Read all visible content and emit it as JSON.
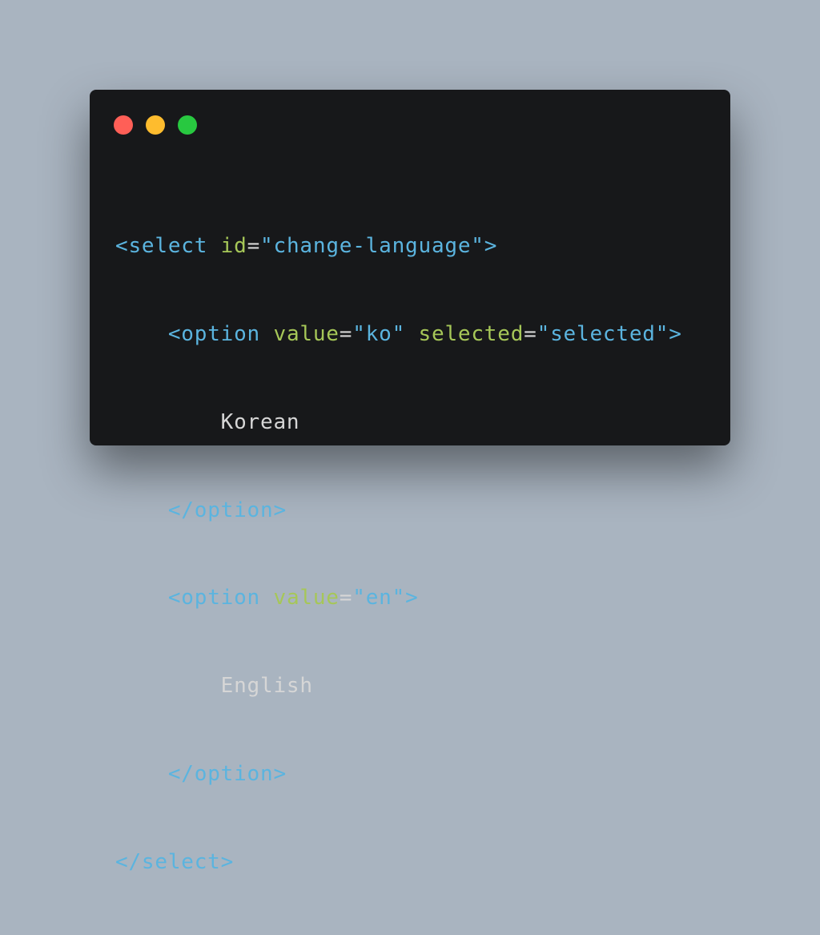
{
  "window": {
    "controls": {
      "close_color": "#ff5f57",
      "minimize_color": "#febc2e",
      "zoom_color": "#28c840"
    }
  },
  "code": {
    "colors": {
      "tag": "#5bb4df",
      "attribute": "#a6c758",
      "string": "#5bb4df",
      "text": "#d6d6d6"
    },
    "lines": [
      {
        "indent": "",
        "open": "<select",
        "attrs": [
          {
            "name": "id",
            "eq": "=",
            "value": "\"change-language\""
          }
        ],
        "close": ">"
      },
      {
        "indent": "    ",
        "open": "<option",
        "attrs": [
          {
            "name": "value",
            "eq": "=",
            "value": "\"ko\""
          },
          {
            "name": "selected",
            "eq": "=",
            "value": "\"selected\""
          }
        ],
        "close": ">"
      },
      {
        "indent": "        ",
        "text": "Korean"
      },
      {
        "indent": "    ",
        "tag": "</option>"
      },
      {
        "indent": "    ",
        "open": "<option",
        "attrs": [
          {
            "name": "value",
            "eq": "=",
            "value": "\"en\""
          }
        ],
        "close": ">"
      },
      {
        "indent": "        ",
        "text": "English"
      },
      {
        "indent": "    ",
        "tag": "</option>"
      },
      {
        "indent": "",
        "tag": "</select>"
      }
    ]
  }
}
